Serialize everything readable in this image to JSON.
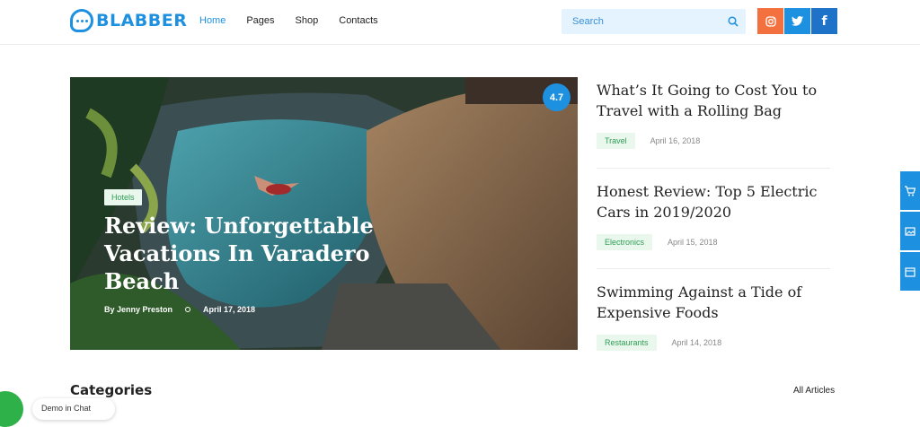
{
  "header": {
    "logo_text": "BLABBER",
    "nav": [
      "Home",
      "Pages",
      "Shop",
      "Contacts"
    ],
    "active_nav": "Home",
    "search_placeholder": "Search",
    "social": [
      "instagram-icon",
      "twitter-icon",
      "facebook-icon"
    ]
  },
  "featured": {
    "rating": "4.7",
    "tag": "Hotels",
    "title": "Review: Unforgettable Vacations In Varadero Beach",
    "author": "By Jenny Preston",
    "date": "April 17, 2018"
  },
  "posts": [
    {
      "title": "What’s It Going to Cost You to Travel with a Rolling Bag",
      "tag": "Travel",
      "date": "April 16, 2018"
    },
    {
      "title": "Honest Review: Top 5 Electric Cars in 2019/2020",
      "tag": "Electronics",
      "date": "April 15, 2018"
    },
    {
      "title": "Swimming Against a Tide of Expensive Foods",
      "tag": "Restaurants",
      "date": "April 14, 2018"
    }
  ],
  "side_tools": [
    "cart-icon",
    "image-icon",
    "calendar-icon"
  ],
  "categories": {
    "title": "Categories",
    "all_link": "All Articles"
  },
  "chat": {
    "label": "Demo in Chat"
  },
  "colors": {
    "accent": "#1e90e0",
    "tag_bg": "#eaf7ed",
    "tag_text": "#2e9e55",
    "instagram": "#f2713e",
    "facebook": "#1e73c8"
  }
}
